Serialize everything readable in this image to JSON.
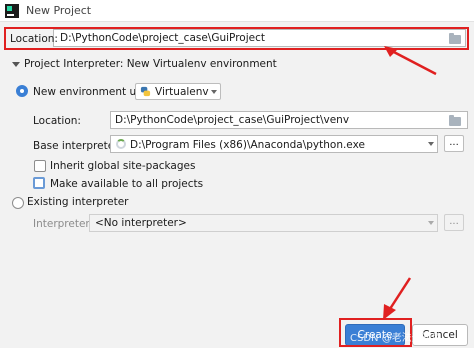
{
  "window": {
    "title": "New Project"
  },
  "location": {
    "label": "Location:",
    "value": "D:\\PythonCode\\project_case\\GuiProject"
  },
  "interpreter_section": {
    "title": "Project Interpreter: New Virtualenv environment"
  },
  "new_env": {
    "radio_label": "New environment using",
    "env_tool": "Virtualenv",
    "location_label": "Location:",
    "location_value": "D:\\PythonCode\\project_case\\GuiProject\\venv",
    "base_label": "Base interpreter:",
    "base_value": "D:\\Program Files (x86)\\Anaconda\\python.exe",
    "browse_label": "...",
    "inherit_label": "Inherit global site-packages",
    "available_label": "Make available to all projects"
  },
  "existing": {
    "radio_label": "Existing interpreter",
    "interpreter_label": "Interpreter:",
    "interpreter_value": "<No interpreter>",
    "browse_label": "..."
  },
  "buttons": {
    "create": "Create",
    "cancel": "Cancel"
  },
  "watermark": "CSDN @老法无知鱼",
  "colors": {
    "accent": "#3a7fd5",
    "highlight": "#e02020"
  },
  "icons": [
    "app-icon",
    "folder-icon",
    "python-icon",
    "chevron-down-icon",
    "spinner-icon"
  ]
}
